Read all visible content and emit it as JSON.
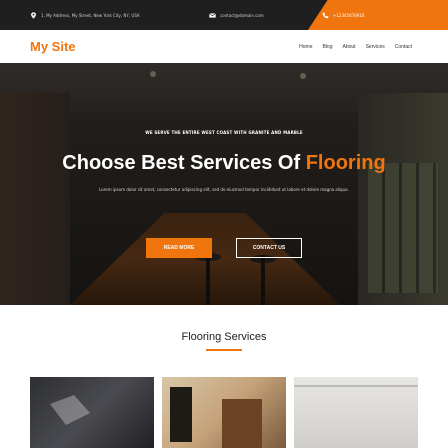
{
  "topbar": {
    "address": "1, My Address, My Street, New York City, NY, USA",
    "email": "contact@domain.com",
    "phone": "+12345678910"
  },
  "navbar": {
    "logo": "My Site",
    "links": [
      "Home",
      "Blog",
      "About",
      "Services",
      "Contact"
    ]
  },
  "hero": {
    "kicker": "WE SERVE THE ENTIRE WEST COAST WITH GRANITE AND MARBLE",
    "title_main": "Choose Best Services Of ",
    "title_accent": "Flooring",
    "subtitle": "Lorem ipsum dolor sit amet, consectetur adipiscing elit, sed do eiusmod tempor incididunt ut labore et dolore magna aliqua.",
    "primary_button": "READ MORE",
    "secondary_button": "CONTACT US"
  },
  "services": {
    "title": "Flooring Services"
  },
  "colors": {
    "accent": "#f0750f",
    "topbar": "#1f1f1f"
  },
  "icons": {
    "address": "map-pin-icon",
    "email": "envelope-icon",
    "phone": "phone-icon"
  }
}
